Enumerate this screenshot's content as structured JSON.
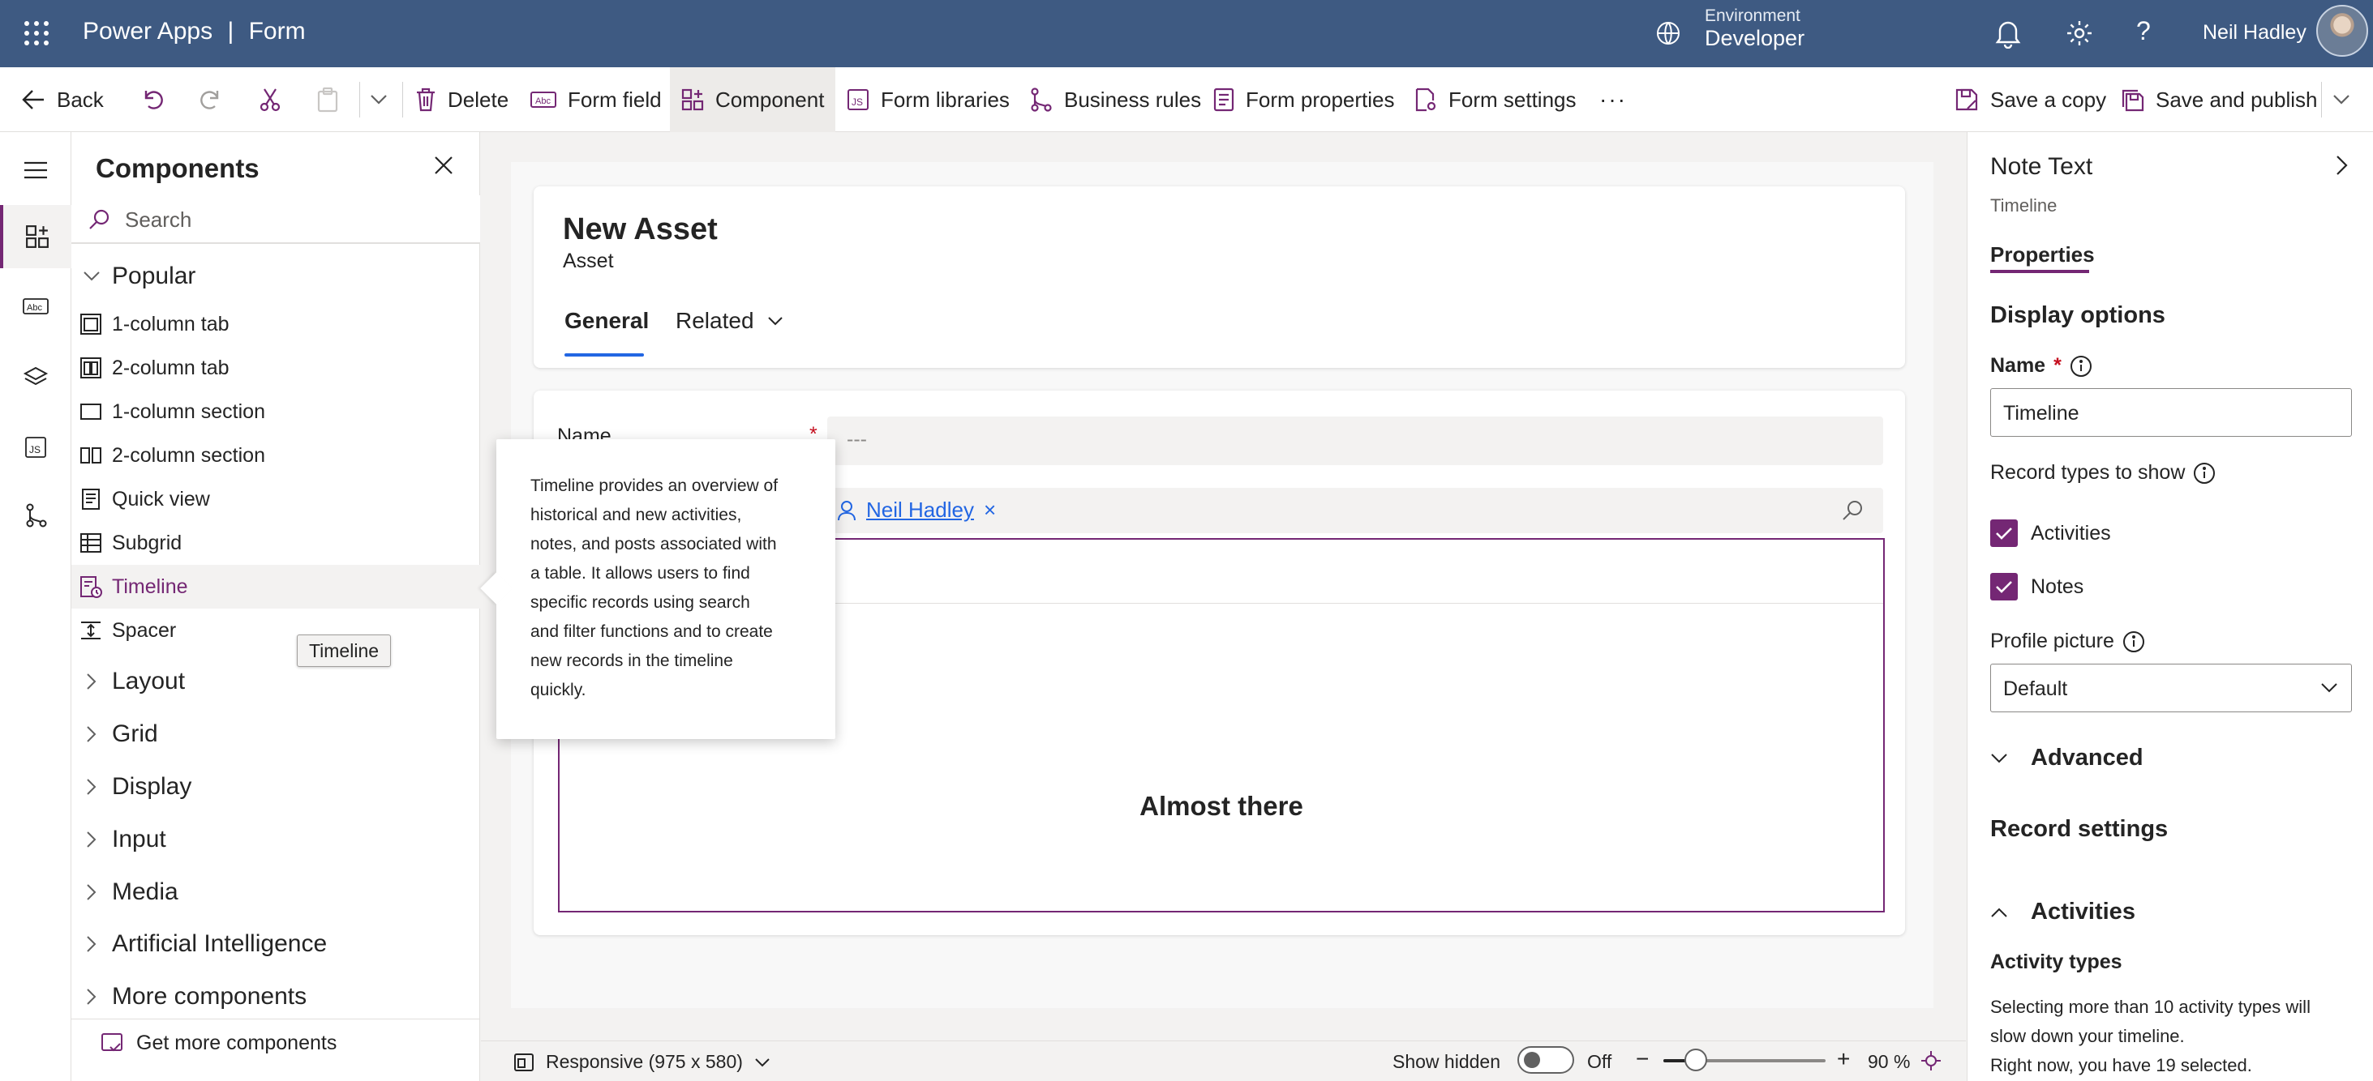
{
  "header": {
    "app_name": "Power Apps",
    "separator": "|",
    "page": "Form",
    "environment_label": "Environment",
    "environment_value": "Developer",
    "user_name": "Neil Hadley",
    "brand_color": "#3e5a82"
  },
  "commands": {
    "back": "Back",
    "delete": "Delete",
    "form_field": "Form field",
    "component": "Component",
    "form_libraries": "Form libraries",
    "business_rules": "Business rules",
    "form_properties": "Form properties",
    "form_settings": "Form settings",
    "more": "···",
    "save_copy": "Save a copy",
    "save_publish": "Save and publish"
  },
  "components_panel": {
    "title": "Components",
    "search_placeholder": "Search",
    "popular_label": "Popular",
    "items": [
      {
        "label": "1-column tab",
        "icon": "one-column-tab-icon"
      },
      {
        "label": "2-column tab",
        "icon": "two-column-tab-icon"
      },
      {
        "label": "1-column section",
        "icon": "one-column-section-icon"
      },
      {
        "label": "2-column section",
        "icon": "two-column-section-icon"
      },
      {
        "label": "Quick view",
        "icon": "quick-view-icon"
      },
      {
        "label": "Subgrid",
        "icon": "subgrid-icon"
      },
      {
        "label": "Timeline",
        "icon": "timeline-icon",
        "selected": true
      },
      {
        "label": "Spacer",
        "icon": "spacer-icon"
      }
    ],
    "groups": [
      "Layout",
      "Grid",
      "Display",
      "Input",
      "Media",
      "Artificial Intelligence",
      "More components"
    ],
    "get_more": "Get more components",
    "hover_tooltip": "Timeline"
  },
  "popover": {
    "text": "Timeline provides an overview of historical and new activities, notes, and posts associated with a table. It allows users to find specific records using search and filter functions and to create new records in the timeline quickly."
  },
  "form": {
    "record_title": "New Asset",
    "record_type": "Asset",
    "tab_general": "General",
    "tab_related": "Related",
    "name_label": "Name",
    "required_marker": "*",
    "name_placeholder": "---",
    "owner_name": "Neil Hadley",
    "owner_remove": "×",
    "timeline_message": "Almost there"
  },
  "properties": {
    "title": "Note Text",
    "subtitle": "Timeline",
    "tab": "Properties",
    "display_options": "Display options",
    "name_label": "Name",
    "required_marker": "*",
    "name_value": "Timeline",
    "record_types_label": "Record types to show",
    "check_activities": "Activities",
    "check_notes": "Notes",
    "profile_picture_label": "Profile picture",
    "profile_picture_value": "Default",
    "advanced": "Advanced",
    "record_settings": "Record settings",
    "activities": "Activities",
    "activity_types": "Activity types",
    "activity_note": "Selecting more than 10 activity types will slow down your timeline.",
    "activity_note2": "Right now, you have 19 selected.",
    "accent_color": "#742774"
  },
  "status_bar": {
    "responsive": "Responsive (975 x 580)",
    "show_hidden": "Show hidden",
    "toggle_state": "Off",
    "zoom": "90 %",
    "zoom_fraction": 0.2
  }
}
